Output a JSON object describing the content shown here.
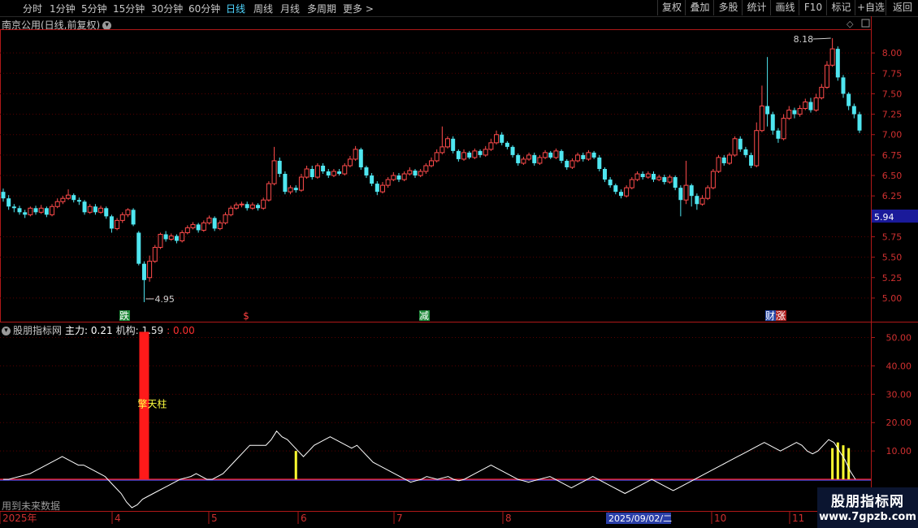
{
  "toolbar": {
    "periods": [
      "分时",
      "1分钟",
      "5分钟",
      "15分钟",
      "30分钟",
      "60分钟",
      "日线",
      "周线",
      "月线",
      "多周期",
      "更多 >"
    ],
    "active_period": "日线",
    "right_buttons": [
      "复权",
      "叠加",
      "多股",
      "统计",
      "画线",
      "F10",
      "标记",
      "+自选",
      "返回"
    ]
  },
  "main": {
    "title": "南京公用(日线,前复权)",
    "current_price_tag": "5.94",
    "high_label": "8.18",
    "low_label": "4.95",
    "price_ticks": [
      "8.00",
      "7.75",
      "7.50",
      "7.25",
      "7.00",
      "6.75",
      "6.50",
      "6.25",
      "5.75",
      "5.50",
      "5.25",
      "5.00"
    ],
    "markers": [
      {
        "text": "跌",
        "color": "#ffffff",
        "bg": "#1f8a3a"
      },
      {
        "text": "$",
        "color": "#ff4040",
        "bg": ""
      },
      {
        "text": "减",
        "color": "#ffffff",
        "bg": "#1f8a3a"
      },
      {
        "text": "财",
        "color": "#ffffff",
        "bg": "#2a4aa8"
      },
      {
        "text": "涨",
        "color": "#ffffff",
        "bg": "#b02020"
      }
    ]
  },
  "indicator": {
    "name": "股朋指标网",
    "main_label": "主力: 0.21",
    "inst_label": "机构: 1.59",
    "extra_value": ": 0.00",
    "ticks": [
      "50.00",
      "40.00",
      "30.00",
      "20.00",
      "10.00"
    ],
    "pillar_label": "擎天柱"
  },
  "x_axis": {
    "labels": [
      "2025年",
      "4",
      "5",
      "6",
      "7",
      "8",
      "9",
      "10",
      "11"
    ],
    "cursor_date": "2025/09/02/二"
  },
  "future_label": "用到未来数据",
  "watermark": {
    "title": "股朋指标网",
    "url": "www.7gpzb.com"
  },
  "colors": {
    "up": "#ff4b4b",
    "down": "#4fe6f0",
    "grid": "#5a0000",
    "axis": "#b01818",
    "line": "#ffffff",
    "spike": "#ffff30",
    "pillar": "#ff1a1a",
    "cursor_bg": "#2a3ea8"
  },
  "chart_data": {
    "type": "candlestick",
    "ylim": [
      4.85,
      8.28
    ],
    "candles": [
      [
        6.3,
        6.22,
        6.34,
        6.18
      ],
      [
        6.22,
        6.12,
        6.26,
        6.08
      ],
      [
        6.12,
        6.1,
        6.15,
        6.05
      ],
      [
        6.1,
        6.05,
        6.13,
        6.02
      ],
      [
        6.05,
        6.02,
        6.08,
        5.98
      ],
      [
        6.02,
        6.1,
        6.12,
        6.0
      ],
      [
        6.1,
        6.05,
        6.13,
        6.02
      ],
      [
        6.05,
        6.1,
        6.14,
        6.03
      ],
      [
        6.1,
        6.02,
        6.12,
        5.99
      ],
      [
        6.02,
        6.12,
        6.15,
        6.0
      ],
      [
        6.12,
        6.18,
        6.22,
        6.1
      ],
      [
        6.18,
        6.22,
        6.25,
        6.15
      ],
      [
        6.22,
        6.26,
        6.33,
        6.2
      ],
      [
        6.26,
        6.2,
        6.28,
        6.17
      ],
      [
        6.2,
        6.18,
        6.23,
        6.14
      ],
      [
        6.18,
        6.05,
        6.2,
        6.02
      ],
      [
        6.05,
        6.12,
        6.15,
        6.03
      ],
      [
        6.12,
        6.05,
        6.15,
        6.02
      ],
      [
        6.05,
        6.1,
        6.13,
        6.03
      ],
      [
        6.1,
        6.0,
        6.12,
        5.97
      ],
      [
        6.0,
        5.85,
        6.02,
        5.8
      ],
      [
        5.85,
        5.95,
        5.98,
        5.83
      ],
      [
        5.95,
        6.02,
        6.05,
        5.92
      ],
      [
        6.02,
        6.08,
        6.1,
        5.99
      ],
      [
        6.08,
        5.9,
        6.1,
        5.88
      ],
      [
        5.8,
        5.42,
        5.82,
        5.4
      ],
      [
        5.42,
        5.22,
        5.45,
        4.95
      ],
      [
        5.25,
        5.45,
        5.52,
        5.2
      ],
      [
        5.45,
        5.62,
        5.65,
        5.43
      ],
      [
        5.62,
        5.78,
        5.8,
        5.6
      ],
      [
        5.78,
        5.72,
        5.82,
        5.69
      ],
      [
        5.72,
        5.76,
        5.79,
        5.7
      ],
      [
        5.76,
        5.7,
        5.78,
        5.67
      ],
      [
        5.7,
        5.8,
        5.83,
        5.68
      ],
      [
        5.8,
        5.86,
        5.89,
        5.78
      ],
      [
        5.86,
        5.9,
        5.93,
        5.84
      ],
      [
        5.9,
        5.83,
        5.92,
        5.8
      ],
      [
        5.83,
        5.92,
        5.95,
        5.81
      ],
      [
        5.92,
        5.98,
        6.01,
        5.9
      ],
      [
        5.98,
        5.85,
        6.0,
        5.82
      ],
      [
        5.85,
        5.92,
        5.95,
        5.83
      ],
      [
        5.92,
        6.02,
        6.05,
        5.9
      ],
      [
        6.02,
        6.1,
        6.13,
        6.0
      ],
      [
        6.1,
        6.14,
        6.17,
        6.08
      ],
      [
        6.14,
        6.15,
        6.18,
        6.11
      ],
      [
        6.15,
        6.1,
        6.18,
        6.07
      ],
      [
        6.1,
        6.14,
        6.17,
        6.08
      ],
      [
        6.14,
        6.1,
        6.16,
        6.07
      ],
      [
        6.1,
        6.2,
        6.23,
        6.08
      ],
      [
        6.2,
        6.4,
        6.43,
        6.18
      ],
      [
        6.4,
        6.68,
        6.85,
        6.38
      ],
      [
        6.68,
        6.52,
        6.72,
        6.48
      ],
      [
        6.52,
        6.3,
        6.55,
        6.27
      ],
      [
        6.3,
        6.35,
        6.38,
        6.27
      ],
      [
        6.35,
        6.32,
        6.38,
        6.29
      ],
      [
        6.32,
        6.48,
        6.52,
        6.3
      ],
      [
        6.48,
        6.58,
        6.62,
        6.46
      ],
      [
        6.58,
        6.48,
        6.62,
        6.45
      ],
      [
        6.48,
        6.62,
        6.65,
        6.46
      ],
      [
        6.62,
        6.55,
        6.65,
        6.52
      ],
      [
        6.55,
        6.5,
        6.58,
        6.47
      ],
      [
        6.5,
        6.55,
        6.58,
        6.48
      ],
      [
        6.55,
        6.52,
        6.58,
        6.5
      ],
      [
        6.52,
        6.62,
        6.65,
        6.5
      ],
      [
        6.62,
        6.7,
        6.74,
        6.6
      ],
      [
        6.7,
        6.82,
        6.86,
        6.68
      ],
      [
        6.82,
        6.6,
        6.84,
        6.57
      ],
      [
        6.6,
        6.5,
        6.62,
        6.47
      ],
      [
        6.5,
        6.4,
        6.53,
        6.37
      ],
      [
        6.4,
        6.3,
        6.43,
        6.26
      ],
      [
        6.3,
        6.38,
        6.42,
        6.28
      ],
      [
        6.38,
        6.45,
        6.48,
        6.35
      ],
      [
        6.45,
        6.5,
        6.54,
        6.43
      ],
      [
        6.5,
        6.45,
        6.53,
        6.42
      ],
      [
        6.45,
        6.52,
        6.55,
        6.43
      ],
      [
        6.52,
        6.56,
        6.6,
        6.5
      ],
      [
        6.56,
        6.5,
        6.58,
        6.47
      ],
      [
        6.5,
        6.55,
        6.58,
        6.48
      ],
      [
        6.55,
        6.62,
        6.65,
        6.52
      ],
      [
        6.62,
        6.68,
        6.72,
        6.6
      ],
      [
        6.68,
        6.78,
        6.82,
        6.66
      ],
      [
        6.78,
        6.85,
        7.1,
        6.76
      ],
      [
        6.85,
        6.95,
        6.98,
        6.83
      ],
      [
        6.95,
        6.8,
        6.98,
        6.77
      ],
      [
        6.8,
        6.7,
        6.82,
        6.67
      ],
      [
        6.7,
        6.78,
        6.82,
        6.68
      ],
      [
        6.78,
        6.72,
        6.8,
        6.7
      ],
      [
        6.72,
        6.8,
        6.83,
        6.7
      ],
      [
        6.8,
        6.75,
        6.82,
        6.72
      ],
      [
        6.75,
        6.82,
        6.86,
        6.73
      ],
      [
        6.82,
        6.9,
        6.95,
        6.8
      ],
      [
        6.9,
        7.0,
        7.05,
        6.88
      ],
      [
        7.0,
        6.9,
        7.03,
        6.87
      ],
      [
        6.9,
        6.85,
        6.92,
        6.82
      ],
      [
        6.85,
        6.75,
        6.87,
        6.72
      ],
      [
        6.75,
        6.65,
        6.77,
        6.62
      ],
      [
        6.65,
        6.7,
        6.73,
        6.63
      ],
      [
        6.7,
        6.75,
        6.78,
        6.68
      ],
      [
        6.75,
        6.65,
        6.78,
        6.62
      ],
      [
        6.65,
        6.72,
        6.75,
        6.63
      ],
      [
        6.72,
        6.78,
        6.81,
        6.7
      ],
      [
        6.78,
        6.72,
        6.8,
        6.7
      ],
      [
        6.72,
        6.8,
        6.83,
        6.7
      ],
      [
        6.8,
        6.68,
        6.82,
        6.65
      ],
      [
        6.68,
        6.6,
        6.7,
        6.57
      ],
      [
        6.6,
        6.68,
        6.71,
        6.58
      ],
      [
        6.68,
        6.75,
        6.78,
        6.66
      ],
      [
        6.75,
        6.7,
        6.78,
        6.67
      ],
      [
        6.7,
        6.78,
        6.81,
        6.68
      ],
      [
        6.78,
        6.72,
        6.8,
        6.7
      ],
      [
        6.72,
        6.58,
        6.75,
        6.55
      ],
      [
        6.58,
        6.45,
        6.6,
        6.42
      ],
      [
        6.45,
        6.38,
        6.48,
        6.35
      ],
      [
        6.38,
        6.3,
        6.4,
        6.27
      ],
      [
        6.3,
        6.25,
        6.33,
        6.22
      ],
      [
        6.25,
        6.35,
        6.38,
        6.23
      ],
      [
        6.35,
        6.45,
        6.48,
        6.33
      ],
      [
        6.45,
        6.52,
        6.55,
        6.43
      ],
      [
        6.52,
        6.48,
        6.55,
        6.45
      ],
      [
        6.48,
        6.52,
        6.55,
        6.46
      ],
      [
        6.52,
        6.45,
        6.55,
        6.42
      ],
      [
        6.45,
        6.48,
        6.51,
        6.43
      ],
      [
        6.48,
        6.42,
        6.51,
        6.39
      ],
      [
        6.42,
        6.48,
        6.51,
        6.4
      ],
      [
        6.48,
        6.35,
        6.5,
        6.32
      ],
      [
        6.35,
        6.2,
        6.38,
        6.0
      ],
      [
        6.2,
        6.38,
        6.68,
        6.15
      ],
      [
        6.38,
        6.25,
        6.4,
        6.12
      ],
      [
        6.25,
        6.15,
        6.28,
        6.08
      ],
      [
        6.15,
        6.22,
        6.26,
        6.13
      ],
      [
        6.22,
        6.35,
        6.38,
        6.2
      ],
      [
        6.35,
        6.55,
        6.58,
        6.33
      ],
      [
        6.55,
        6.72,
        6.75,
        6.53
      ],
      [
        6.72,
        6.65,
        6.75,
        6.62
      ],
      [
        6.65,
        6.75,
        6.78,
        6.63
      ],
      [
        6.75,
        6.95,
        6.98,
        6.73
      ],
      [
        6.95,
        6.82,
        6.98,
        6.79
      ],
      [
        6.82,
        6.75,
        6.85,
        6.72
      ],
      [
        6.75,
        6.62,
        6.78,
        6.59
      ],
      [
        6.62,
        7.05,
        7.15,
        6.6
      ],
      [
        7.05,
        7.35,
        7.6,
        7.03
      ],
      [
        7.35,
        7.25,
        7.95,
        7.1
      ],
      [
        7.25,
        7.05,
        7.28,
        7.0
      ],
      [
        7.05,
        6.95,
        7.08,
        6.9
      ],
      [
        6.95,
        7.2,
        7.25,
        6.93
      ],
      [
        7.2,
        7.3,
        7.35,
        7.18
      ],
      [
        7.3,
        7.25,
        7.33,
        7.2
      ],
      [
        7.25,
        7.32,
        7.36,
        7.22
      ],
      [
        7.32,
        7.4,
        7.44,
        7.3
      ],
      [
        7.4,
        7.3,
        7.45,
        7.27
      ],
      [
        7.3,
        7.45,
        7.5,
        7.28
      ],
      [
        7.45,
        7.58,
        7.62,
        7.43
      ],
      [
        7.58,
        7.85,
        7.9,
        7.56
      ],
      [
        7.85,
        8.05,
        8.18,
        7.83
      ],
      [
        8.05,
        7.7,
        8.08,
        7.66
      ],
      [
        7.7,
        7.5,
        7.73,
        7.45
      ],
      [
        7.5,
        7.35,
        7.52,
        7.3
      ],
      [
        7.35,
        7.25,
        7.38,
        7.2
      ],
      [
        7.25,
        7.05,
        7.28,
        7.02
      ]
    ],
    "indicator_ylim": [
      -10,
      53
    ],
    "indicator_line": [
      0,
      0,
      0.5,
      1,
      1.5,
      2,
      3,
      4,
      5,
      6,
      7,
      8,
      7,
      6,
      5,
      5,
      4,
      3,
      2,
      1,
      -1,
      -3,
      -5,
      -8,
      -10,
      -9,
      -7,
      -6,
      -5,
      -4,
      -3,
      -2,
      -1,
      0,
      0.5,
      1,
      2,
      1,
      0,
      0,
      1,
      2,
      4,
      6,
      8,
      10,
      12,
      12,
      12,
      12,
      14,
      17,
      15,
      14,
      12,
      10,
      8,
      10,
      12,
      13,
      14,
      15,
      14,
      13,
      12,
      11,
      12,
      10,
      8,
      6,
      5,
      4,
      3,
      2,
      1,
      0,
      -1,
      -0.5,
      0,
      1,
      0.5,
      0,
      0.5,
      1,
      0,
      -0.5,
      0,
      1,
      2,
      3,
      4,
      5,
      4,
      3,
      2,
      1,
      0,
      -0.5,
      -1,
      -0.5,
      0,
      0.5,
      1,
      0,
      -1,
      -2,
      -3,
      -2,
      -1,
      0,
      1,
      0,
      -1,
      -2,
      -3,
      -4,
      -5,
      -4,
      -3,
      -2,
      -1,
      0,
      -1,
      -2,
      -3,
      -4,
      -3,
      -2,
      -1,
      0,
      1,
      2,
      3,
      4,
      5,
      6,
      7,
      8,
      9,
      10,
      11,
      12,
      13,
      12,
      11,
      10,
      11,
      12,
      13,
      12,
      10,
      9,
      10,
      12,
      14,
      13,
      10,
      7,
      3,
      0
    ],
    "indicator_spikes": [
      [
        54,
        10
      ],
      [
        153,
        11
      ],
      [
        154,
        13
      ],
      [
        155,
        12
      ],
      [
        156,
        11
      ]
    ],
    "pillar": [
      26,
      52
    ]
  }
}
